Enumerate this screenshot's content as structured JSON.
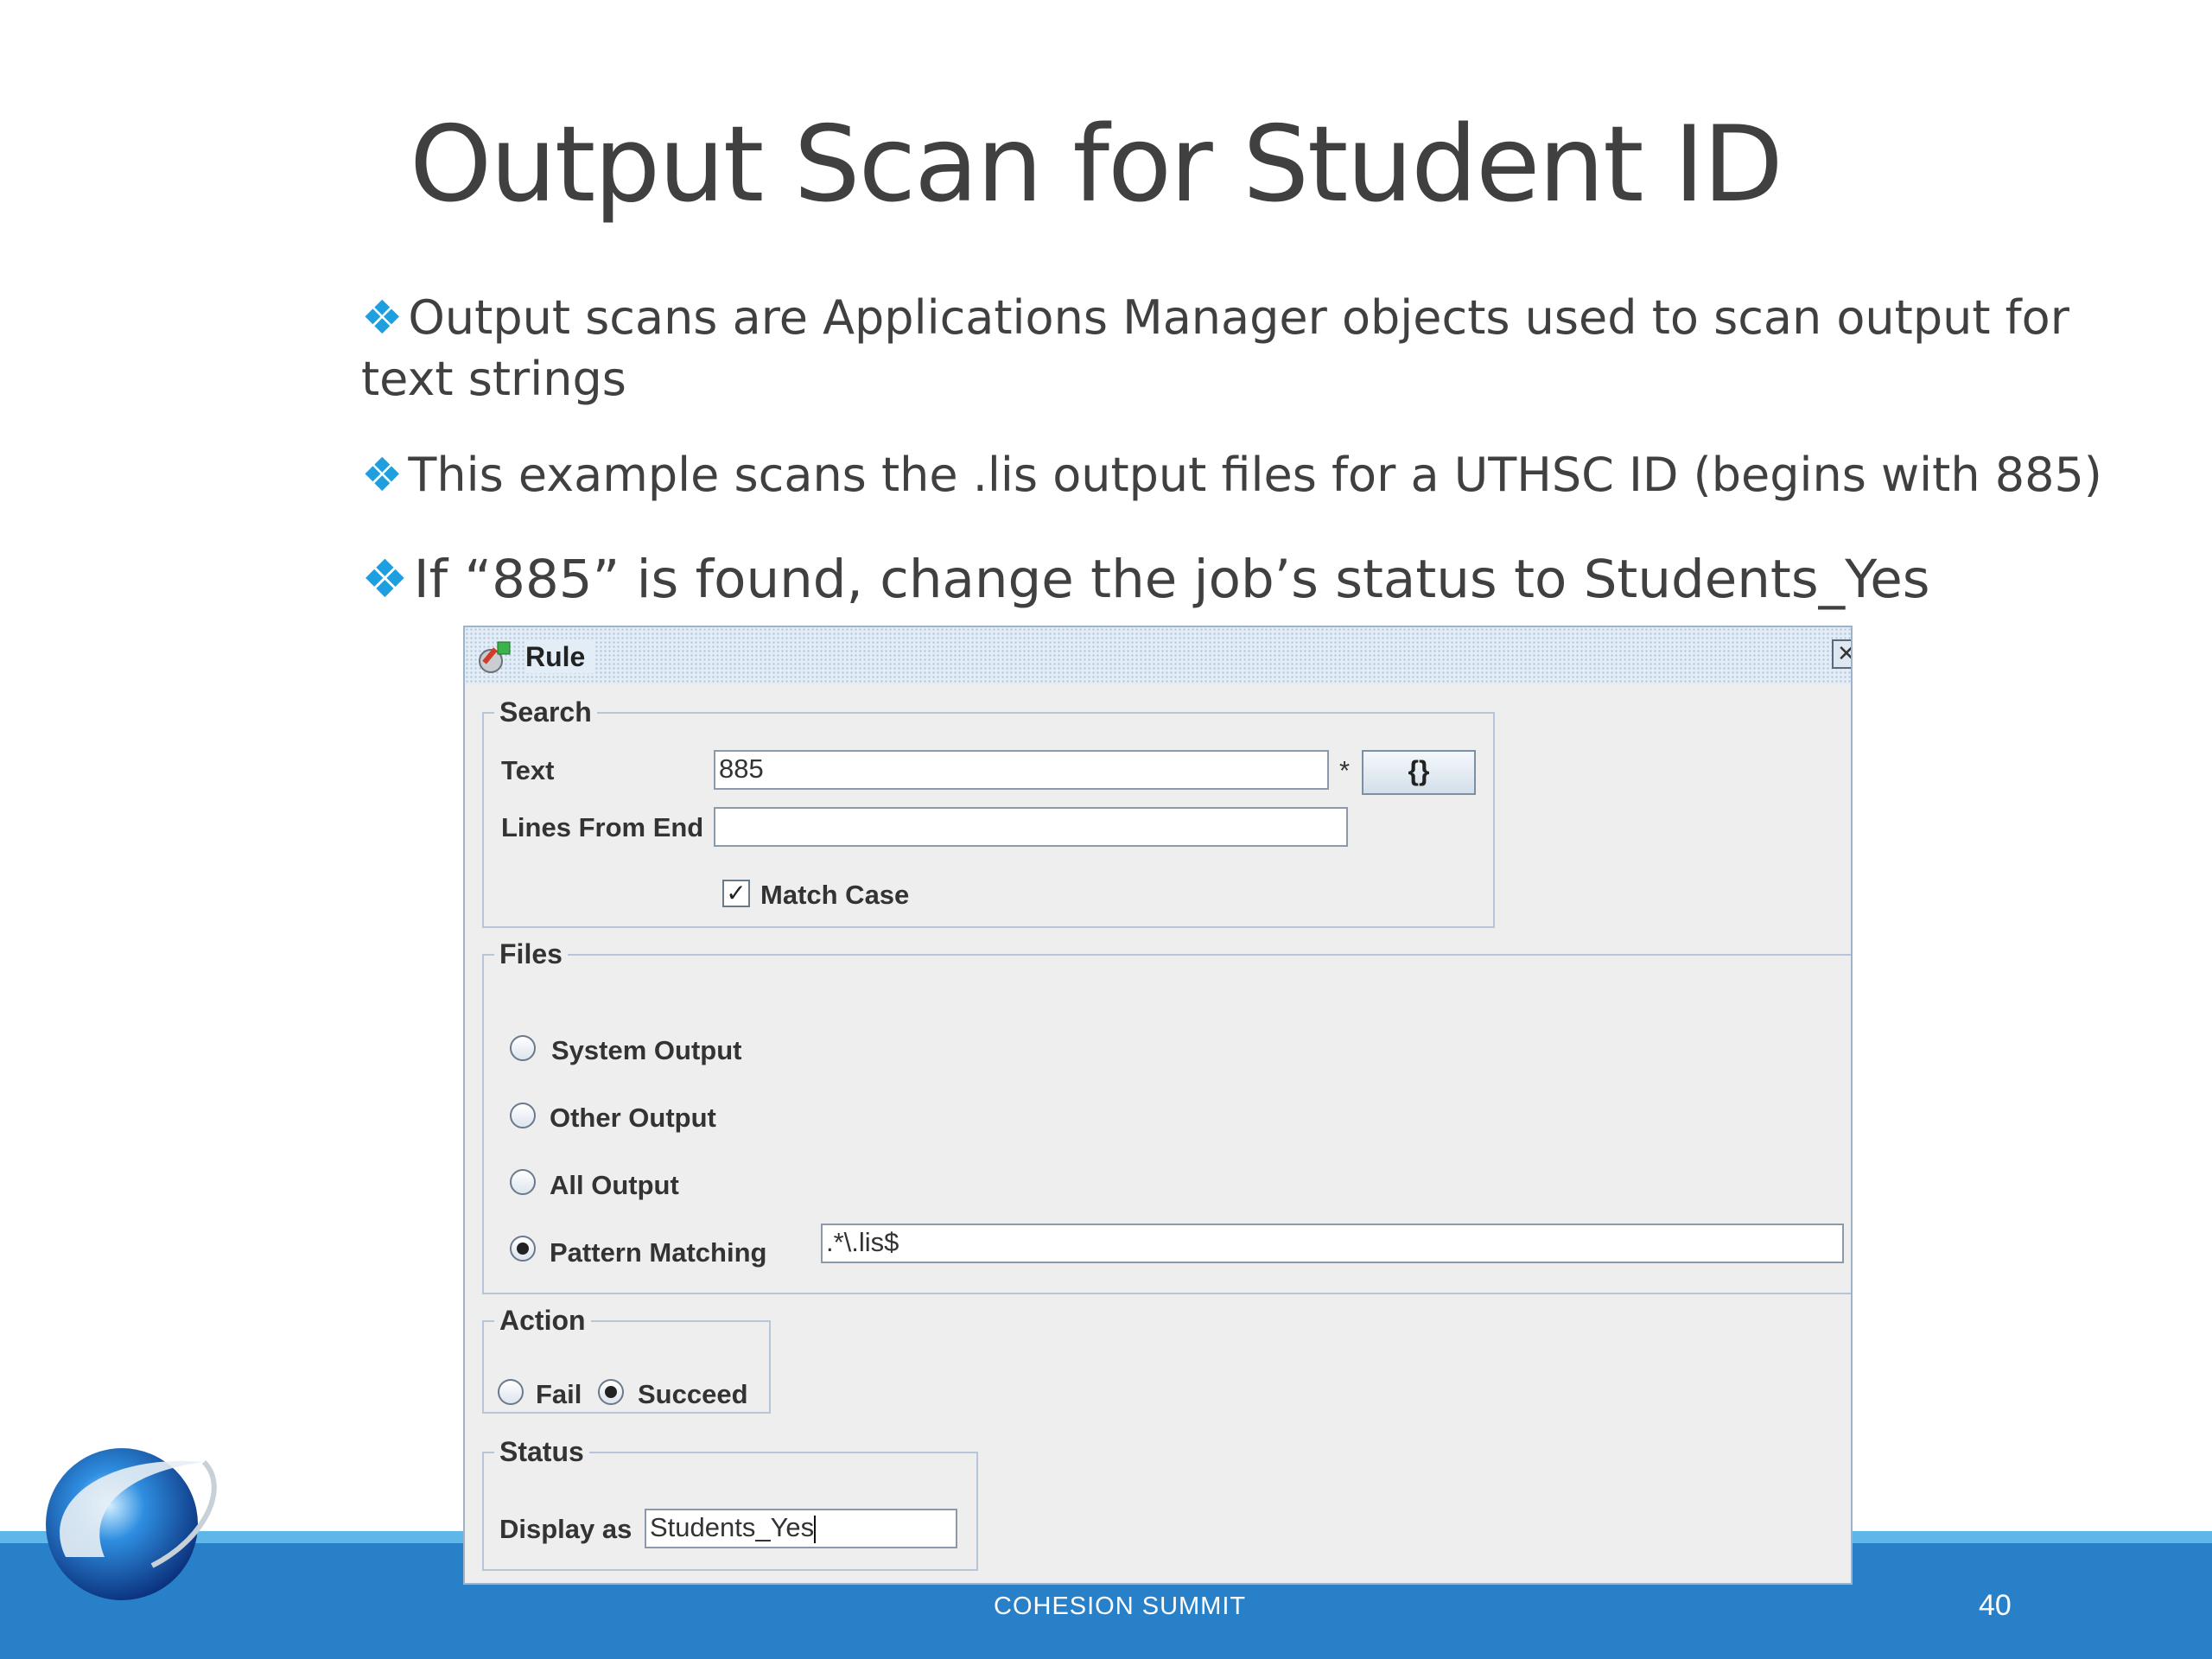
{
  "slide": {
    "title": "Output Scan for Student ID",
    "bullet_marker": "❖",
    "bullets": [
      "Output scans are Applications Manager objects used to scan output for text strings",
      "This example scans the .lis output files for a UTHSC ID (begins with 885)",
      "If “885” is found, change the job’s status to Students_Yes"
    ],
    "footer": "COHESION SUMMIT",
    "page_number": "40"
  },
  "dialog": {
    "title": "Rule",
    "title_icon": "rule-icon",
    "close_icon": "close-icon",
    "search": {
      "legend": "Search",
      "text_label": "Text",
      "text_value": "885",
      "required_marker": "*",
      "variables_button": "{}",
      "lines_label": "Lines From End",
      "lines_value": "",
      "match_case_label": "Match Case",
      "match_case_checked": true
    },
    "files": {
      "legend": "Files",
      "options": [
        "System Output",
        "Other Output",
        "All Output",
        "Pattern Matching"
      ],
      "selected": "Pattern Matching",
      "pattern_value": ".*\\.lis$"
    },
    "action": {
      "legend": "Action",
      "options": [
        "Fail",
        "Succeed"
      ],
      "selected": "Succeed"
    },
    "status": {
      "legend": "Status",
      "display_label": "Display as",
      "display_value": "Students_Yes"
    }
  },
  "colors": {
    "accent": "#1e9fdf",
    "footer_bar": "#2880c8",
    "dialog_bg": "#eeeeee"
  }
}
